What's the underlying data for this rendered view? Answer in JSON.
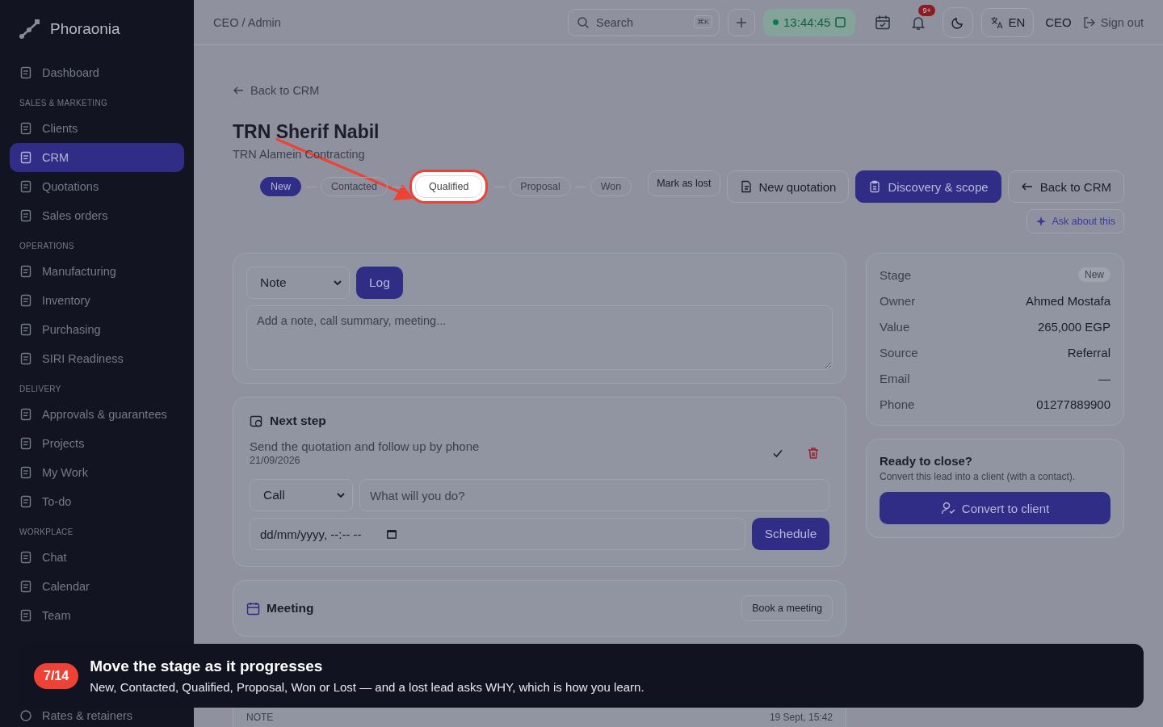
{
  "brand": "Phoraonia",
  "sidebar": {
    "groups": [
      {
        "items": [
          {
            "label": "Dashboard",
            "selected": false
          }
        ]
      },
      {
        "label": "SALES & MARKETING",
        "items": [
          {
            "label": "Clients",
            "selected": false
          },
          {
            "label": "CRM",
            "selected": true
          },
          {
            "label": "Quotations",
            "selected": false
          },
          {
            "label": "Sales orders",
            "selected": false
          }
        ]
      },
      {
        "label": "OPERATIONS",
        "items": [
          {
            "label": "Manufacturing",
            "selected": false
          },
          {
            "label": "Inventory",
            "selected": false
          },
          {
            "label": "Purchasing",
            "selected": false
          },
          {
            "label": "SIRI Readiness",
            "selected": false
          }
        ]
      },
      {
        "label": "DELIVERY",
        "items": [
          {
            "label": "Approvals & guarantees",
            "selected": false
          },
          {
            "label": "Projects",
            "selected": false
          },
          {
            "label": "My Work",
            "selected": false
          },
          {
            "label": "To-do",
            "selected": false
          }
        ]
      },
      {
        "label": "WORKPLACE",
        "items": [
          {
            "label": "Chat",
            "selected": false
          },
          {
            "label": "Calendar",
            "selected": false
          },
          {
            "label": "Team",
            "selected": false
          }
        ]
      }
    ],
    "bottom_item": "Rates & retainers"
  },
  "topbar": {
    "breadcrumb": "CEO / Admin",
    "search": {
      "placeholder": "Search",
      "shortcut": "⌘K"
    },
    "clock": "13:44:45",
    "notifications_badge": "9+",
    "language": "EN",
    "role": "CEO",
    "sign_out": "Sign out"
  },
  "back_link": "Back to CRM",
  "lead": {
    "name": "TRN Sherif Nabil",
    "company": "TRN Alamein Contracting"
  },
  "stages": [
    {
      "label": "New",
      "selected": true,
      "spotlight": false
    },
    {
      "label": "Contacted",
      "selected": false,
      "spotlight": false
    },
    {
      "label": "Qualified",
      "selected": false,
      "spotlight": true
    },
    {
      "label": "Proposal",
      "selected": false,
      "spotlight": false
    },
    {
      "label": "Won",
      "selected": false,
      "spotlight": false
    }
  ],
  "actions": [
    {
      "label": "Mark as lost",
      "kind": "small"
    },
    {
      "label": "New quotation",
      "kind": "doc"
    },
    {
      "label": "Discovery & scope",
      "kind": "primary"
    },
    {
      "label": "Back to CRM",
      "kind": "back"
    }
  ],
  "ask_link": "Ask about this",
  "log_card": {
    "type": "Note",
    "button": "Log",
    "placeholder": "Add a note, call summary, meeting..."
  },
  "next_step": {
    "title": "Next step",
    "task": "Send the quotation and follow up by phone",
    "date": "21/09/2026",
    "type": "Call",
    "placeholder": "What will you do?",
    "datetime": "dd/mm/yyyy, --:-- --",
    "button": "Schedule"
  },
  "meeting": {
    "title": "Meeting",
    "button": "Book a meeting"
  },
  "activity": {
    "kind": "NOTE",
    "time": "19 Sept, 15:42"
  },
  "details": [
    {
      "label": "Stage",
      "value": "New",
      "kind": "badge"
    },
    {
      "label": "Owner",
      "value": "Ahmed Mostafa",
      "kind": "text"
    },
    {
      "label": "Value",
      "value": "265,000 EGP",
      "kind": "text"
    },
    {
      "label": "Source",
      "value": "Referral",
      "kind": "text"
    },
    {
      "label": "Email",
      "value": "—",
      "kind": "text"
    },
    {
      "label": "Phone",
      "value": "01277889900",
      "kind": "text"
    }
  ],
  "close_card": {
    "title": "Ready to close?",
    "text": "Convert this lead into a client (with a contact).",
    "button": "Convert to client"
  },
  "tour": {
    "step": "7/14",
    "title": "Move the stage as it progresses",
    "text": "New, Contacted, Qualified, Proposal, Won or Lost — and a lost lead asks WHY, which is how you learn."
  }
}
